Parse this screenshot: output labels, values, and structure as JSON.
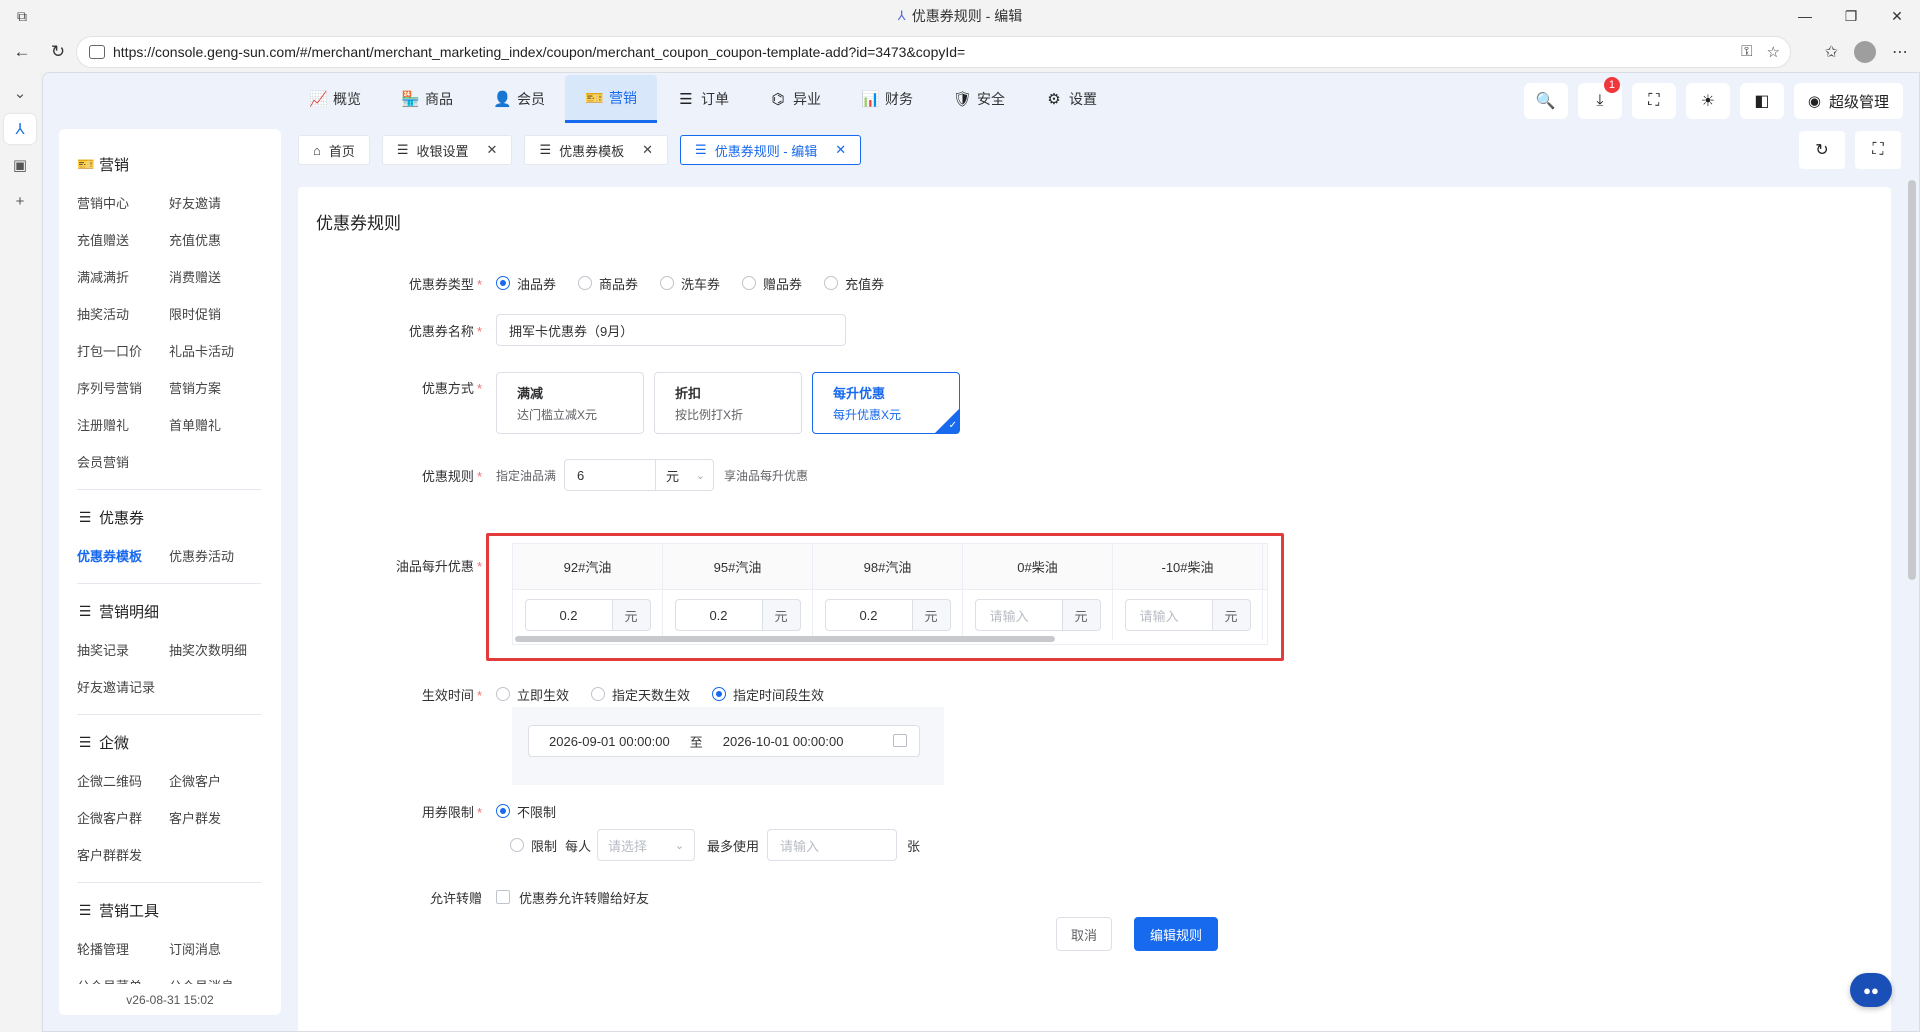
{
  "browser": {
    "tab_title": "优惠券规则 - 编辑",
    "url": "https://console.geng-sun.com/#/merchant/merchant_marketing_index/coupon/merchant_coupon_coupon-template-add?id=3473&copyId=",
    "window_controls": [
      "minimize-icon",
      "restore-icon",
      "close-icon"
    ]
  },
  "topnav": {
    "items": [
      {
        "icon": "chart-icon",
        "label": "概览"
      },
      {
        "icon": "shop-icon",
        "label": "商品"
      },
      {
        "icon": "member-icon",
        "label": "会员"
      },
      {
        "icon": "marketing-icon",
        "label": "营销"
      },
      {
        "icon": "order-icon",
        "label": "异业"
      },
      {
        "icon": "list-icon",
        "label": "订单"
      },
      {
        "icon": "finance-icon",
        "label": "财务"
      },
      {
        "icon": "security-icon",
        "label": "安全"
      },
      {
        "icon": "gear-icon",
        "label": "设置"
      }
    ],
    "active": "营销",
    "download_badge": "1",
    "user_label": "超级管理"
  },
  "sidebar": {
    "sections": [
      {
        "title": "营销",
        "icon": "marketing-icon",
        "links": [
          "营销中心",
          "好友邀请",
          "充值赠送",
          "充值优惠",
          "满减满折",
          "消费赠送",
          "抽奖活动",
          "限时促销",
          "打包一口价",
          "礼品卡活动",
          "序列号营销",
          "营销方案",
          "注册赠礼",
          "首单赠礼",
          "会员营销"
        ]
      },
      {
        "title": "优惠券",
        "icon": "menu-icon",
        "links": [
          "优惠券模板",
          "优惠券活动"
        ]
      },
      {
        "title": "营销明细",
        "icon": "menu-icon",
        "links": [
          "抽奖记录",
          "抽奖次数明细",
          "好友邀请记录"
        ]
      },
      {
        "title": "企微",
        "icon": "menu-icon",
        "links": [
          "企微二维码",
          "企微客户",
          "企微客户群",
          "客户群发",
          "客户群群发"
        ]
      },
      {
        "title": "营销工具",
        "icon": "menu-icon",
        "links": [
          "轮播管理",
          "订阅消息",
          "公众号菜单",
          "公众号消息"
        ]
      }
    ],
    "active_link": "优惠券模板",
    "version": "v26-08-31 15:02"
  },
  "tabs": [
    {
      "icon": "home-icon",
      "label": "首页",
      "closable": false
    },
    {
      "icon": "menu-icon",
      "label": "收银设置",
      "closable": true
    },
    {
      "icon": "menu-icon",
      "label": "优惠券模板",
      "closable": true
    },
    {
      "icon": "menu-icon",
      "label": "优惠券规则 - 编辑",
      "closable": true,
      "active": true
    }
  ],
  "form": {
    "page_title": "优惠券规则",
    "coupon_type": {
      "label": "优惠券类型",
      "options": [
        "油品券",
        "商品券",
        "洗车券",
        "赠品券",
        "充值券"
      ],
      "selected": "油品券"
    },
    "coupon_name": {
      "label": "优惠券名称",
      "value": "拥军卡优惠券（9月）"
    },
    "discount_mode": {
      "label": "优惠方式",
      "cards": [
        {
          "title": "满减",
          "desc": "达门槛立减X元"
        },
        {
          "title": "折扣",
          "desc": "按比例打X折"
        },
        {
          "title": "每升优惠",
          "desc": "每升优惠X元"
        }
      ],
      "selected": "每升优惠"
    },
    "rule": {
      "label": "优惠规则",
      "prefix": "指定油品满",
      "value": "6",
      "unit": "元",
      "suffix": "享油品每升优惠"
    },
    "per_liter": {
      "label": "油品每升优惠",
      "columns": [
        {
          "name": "92#汽油",
          "value": "0.2",
          "placeholder": ""
        },
        {
          "name": "95#汽油",
          "value": "0.2",
          "placeholder": ""
        },
        {
          "name": "98#汽油",
          "value": "0.2",
          "placeholder": ""
        },
        {
          "name": "0#柴油",
          "value": "",
          "placeholder": "请输入"
        },
        {
          "name": "-10#柴油",
          "value": "",
          "placeholder": "请输入"
        }
      ],
      "unit": "元"
    },
    "effective": {
      "label": "生效时间",
      "options": [
        "立即生效",
        "指定天数生效",
        "指定时间段生效"
      ],
      "selected": "指定时间段生效",
      "start": "2026-09-01 00:00:00",
      "sep": "至",
      "end": "2026-10-01 00:00:00"
    },
    "usage_limit": {
      "label": "用券限制",
      "opt_unlimited": "不限制",
      "opt_limited": "限制",
      "per_person": "每人",
      "select_placeholder": "请选择",
      "max_use": "最多使用",
      "input_placeholder": "请输入",
      "unit": "张",
      "selected": "不限制"
    },
    "transfer": {
      "label": "允许转赠",
      "checkbox_label": "优惠券允许转赠给好友",
      "checked": false
    },
    "buttons": {
      "cancel": "取消",
      "submit": "编辑规则"
    }
  }
}
